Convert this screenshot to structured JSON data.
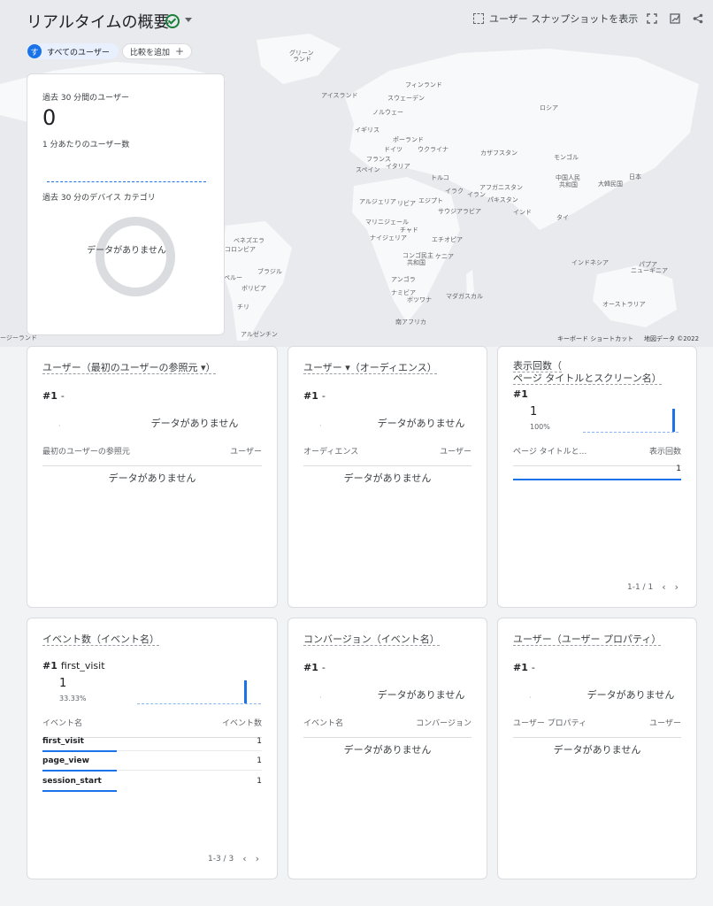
{
  "header": {
    "title": "リアルタイムの概要",
    "snapshot_label": "ユーザー スナップショットを表示"
  },
  "filters": {
    "user_chip_initial": "す",
    "user_chip_label": "すべてのユーザー",
    "add_compare_label": "比較を追加"
  },
  "map": {
    "labels": [
      "グリーン",
      "ランド",
      "アイスランド",
      "フィンランド",
      "スウェーデン",
      "ノルウェー",
      "ロシア",
      "イギリス",
      "ポーランド",
      "ドイツ",
      "ウクライナ",
      "フランス",
      "イタリア",
      "スペイン",
      "カザフスタン",
      "モンゴル",
      "トルコ",
      "アフガニスタン",
      "中国人民",
      "共和国",
      "大韓民国",
      "日本",
      "イラク",
      "イラン",
      "パキスタン",
      "インド",
      "タイ",
      "アルジェリア",
      "リビア",
      "エジプト",
      "サウジアラビア",
      "マリ",
      "ニジェール",
      "チャド",
      "ナイジェリア",
      "エチオピア",
      "ベネズエラ",
      "コロンビア",
      "コンゴ民主",
      "共和国",
      "ケニア",
      "ブラジル",
      "ペルー",
      "ボリビア",
      "アンゴラ",
      "インドネシア",
      "パプア",
      "ニューギニア",
      "ナミビア",
      "ボツワナ",
      "マダガスカル",
      "チリ",
      "南アフリカ",
      "オーストラリア",
      "アルゼンチン",
      "ージーランド"
    ],
    "keyboard_shortcuts": "キーボード ショートカット",
    "map_data": "地図データ ©2022"
  },
  "realtime_card": {
    "users_30min_label": "過去 30 分間のユーザー",
    "users_30min_value": "0",
    "per_minute_label": "1 分あたりのユーザー数",
    "device_label": "過去 30 分のデバイス カテゴリ",
    "no_data": "データがありません"
  },
  "cards": {
    "first_source": {
      "title": "ユーザー（最初のユーザーの参照元 ▾）",
      "rank": "#1",
      "rank_value": "-",
      "no_data_top": "データがありません",
      "col1": "最初のユーザーの参照元",
      "col2": "ユーザー",
      "no_data_table": "データがありません"
    },
    "audience": {
      "title": "ユーザー ▾（オーディエンス）",
      "rank": "#1",
      "rank_value": "-",
      "no_data_top": "データがありません",
      "col1": "オーディエンス",
      "col2": "ユーザー",
      "no_data_table": "データがありません"
    },
    "page_views": {
      "title_line1": "表示回数（",
      "title_line2": "ページ タイトルとスクリーン名）",
      "rank": "#1",
      "big_value": "1",
      "percent": "100%",
      "col1": "ページ タイトルと...",
      "col2": "表示回数",
      "row_value": "1",
      "pager": "1-1 / 1"
    },
    "events": {
      "title": "イベント数（イベント名）",
      "rank": "#1",
      "rank_value": "first_visit",
      "big_value": "1",
      "percent": "33.33%",
      "col1": "イベント名",
      "col2": "イベント数",
      "rows": [
        {
          "name": "first_visit",
          "value": "1"
        },
        {
          "name": "page_view",
          "value": "1"
        },
        {
          "name": "session_start",
          "value": "1"
        }
      ],
      "pager": "1-3 / 3"
    },
    "conversions": {
      "title": "コンバージョン（イベント名）",
      "rank": "#1",
      "rank_value": "-",
      "no_data_top": "データがありません",
      "col1": "イベント名",
      "col2": "コンバージョン",
      "no_data_table": "データがありません"
    },
    "user_property": {
      "title": "ユーザー（ユーザー プロパティ）",
      "rank": "#1",
      "rank_value": "-",
      "no_data_top": "データがありません",
      "col1": "ユーザー プロパティ",
      "col2": "ユーザー",
      "no_data_table": "データがありません"
    }
  }
}
